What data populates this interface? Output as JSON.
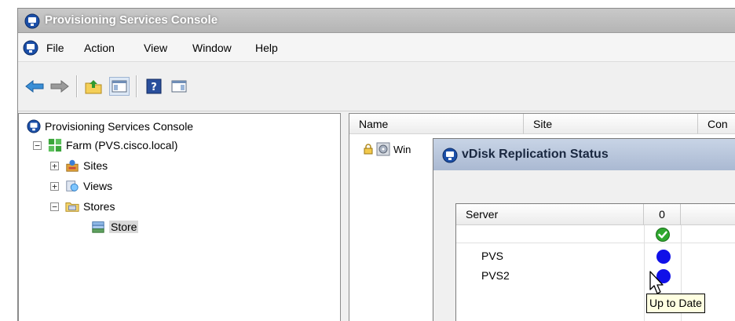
{
  "app": {
    "title": "Provisioning Services Console"
  },
  "menu": {
    "items": [
      "File",
      "Action",
      "View",
      "Window",
      "Help"
    ]
  },
  "toolbar": {
    "buttons": [
      "back-arrow-icon",
      "forward-arrow-icon",
      "up-folder-icon",
      "show-hide-tree-icon",
      "help-icon",
      "action-pane-icon"
    ]
  },
  "tree": {
    "root": "Provisioning Services Console",
    "farm": "Farm (PVS.cisco.local)",
    "sites": "Sites",
    "views": "Views",
    "stores": "Stores",
    "store": "Store",
    "expander_collapsed": "+",
    "expander_expanded": "−"
  },
  "list": {
    "columns": [
      "Name",
      "Site",
      "Con"
    ],
    "rows": [
      {
        "name": "Win"
      }
    ]
  },
  "dialog": {
    "title": "vDisk Replication Status",
    "columns": [
      "Server",
      "0"
    ],
    "rows": [
      {
        "server": "",
        "status": "ok-check-icon"
      },
      {
        "server": "PVS",
        "status": "up-to-date-dot"
      },
      {
        "server": "PVS2",
        "status": "up-to-date-dot"
      }
    ],
    "tooltip": "Up to Date"
  },
  "colors": {
    "status_blue": "#1010e8",
    "check_green": "#2fa82f"
  }
}
